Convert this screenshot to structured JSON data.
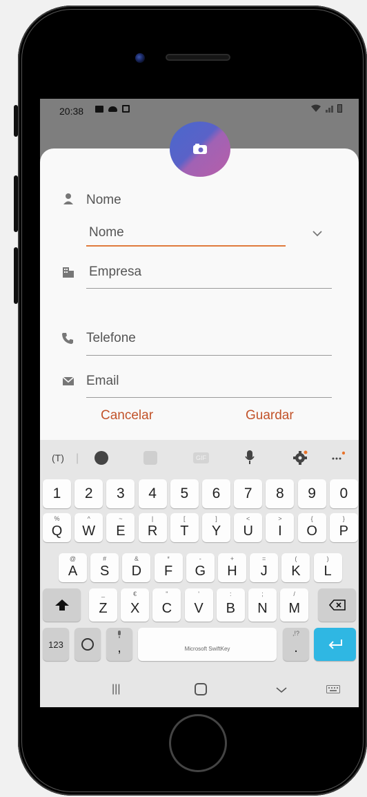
{
  "status_bar": {
    "time": "20:38"
  },
  "form": {
    "name_label": "Nome",
    "name_dropdown_value": "Nome",
    "company_label": "Empresa",
    "phone_label": "Telefone",
    "email_label": "Email"
  },
  "actions": {
    "cancel": "Cancelar",
    "save": "Guardar"
  },
  "keyboard": {
    "toolbar": {
      "gif_label": "GIF"
    },
    "number_row": [
      "1",
      "2",
      "3",
      "4",
      "5",
      "6",
      "7",
      "8",
      "9",
      "0"
    ],
    "row1": [
      {
        "main": "Q",
        "hint": "%"
      },
      {
        "main": "W",
        "hint": "^"
      },
      {
        "main": "E",
        "hint": "~"
      },
      {
        "main": "R",
        "hint": "|"
      },
      {
        "main": "T",
        "hint": "["
      },
      {
        "main": "Y",
        "hint": "]"
      },
      {
        "main": "U",
        "hint": "<"
      },
      {
        "main": "I",
        "hint": ">"
      },
      {
        "main": "O",
        "hint": "{"
      },
      {
        "main": "P",
        "hint": "}"
      }
    ],
    "row2": [
      {
        "main": "A",
        "hint": "@"
      },
      {
        "main": "S",
        "hint": "#"
      },
      {
        "main": "D",
        "hint": "&"
      },
      {
        "main": "F",
        "hint": "*"
      },
      {
        "main": "G",
        "hint": "-"
      },
      {
        "main": "H",
        "hint": "+"
      },
      {
        "main": "J",
        "hint": "="
      },
      {
        "main": "K",
        "hint": "("
      },
      {
        "main": "L",
        "hint": ")"
      }
    ],
    "row3": [
      {
        "main": "Z",
        "hint": "_"
      },
      {
        "main": "X",
        "hint": "€"
      },
      {
        "main": "C",
        "hint": "\""
      },
      {
        "main": "V",
        "hint": "'"
      },
      {
        "main": "B",
        "hint": ":"
      },
      {
        "main": "N",
        "hint": ";"
      },
      {
        "main": "M",
        "hint": "/"
      }
    ],
    "symbols_key": "123",
    "comma_key": ",",
    "period_key": ".",
    "period_hint": ",!?",
    "space_label": "Microsoft SwiftKey"
  },
  "colors": {
    "accent": "#c2532a",
    "focus_line": "#e07a3c",
    "enter_key": "#2fb7e3"
  }
}
